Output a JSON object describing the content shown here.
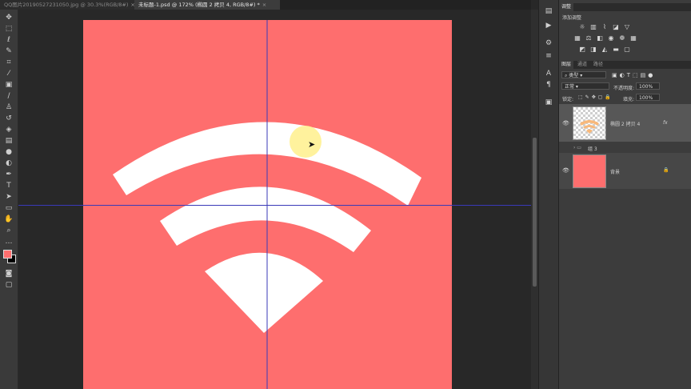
{
  "tabs": [
    {
      "label": "QQ图片20190527231050.jpg @ 30.3%(RGB/8#)",
      "close": "×"
    },
    {
      "label": "未标题-1.psd @ 172% (椭圆 2 拷贝 4, RGB/8#) *",
      "close": "×"
    }
  ],
  "toolbar": {
    "tools": [
      "move-tool",
      "marquee-tool",
      "lasso-tool",
      "quick-select-tool",
      "crop-tool",
      "eyedropper-tool",
      "healing-brush-tool",
      "brush-tool",
      "clone-stamp-tool",
      "history-brush-tool",
      "eraser-tool",
      "gradient-tool",
      "blur-tool",
      "dodge-tool",
      "pen-tool",
      "type-tool",
      "path-select-tool",
      "rectangle-tool",
      "hand-tool",
      "zoom-tool",
      "more-tools"
    ],
    "foreground_color": "#fe6e6e",
    "background_color": "#000000"
  },
  "canvas": {
    "background_color": "#fe6e6e",
    "shape_color": "#ffffff",
    "guide_color": "#3a3ab8"
  },
  "panels": {
    "adjustments": {
      "tab": "调整",
      "add_label": "添加调整"
    },
    "layers": {
      "tabs": [
        "图层",
        "通道",
        "路径"
      ],
      "filter_kind": "类型",
      "blend_mode": "正常",
      "opacity_label": "不透明度:",
      "opacity_value": "100%",
      "lock_label": "锁定:",
      "fill_label": "填充:",
      "fill_value": "100%",
      "items": [
        {
          "name": "椭圆 2 拷贝 4",
          "fx": "fx"
        },
        {
          "name": "组 3"
        },
        {
          "name": "背景"
        }
      ]
    }
  }
}
